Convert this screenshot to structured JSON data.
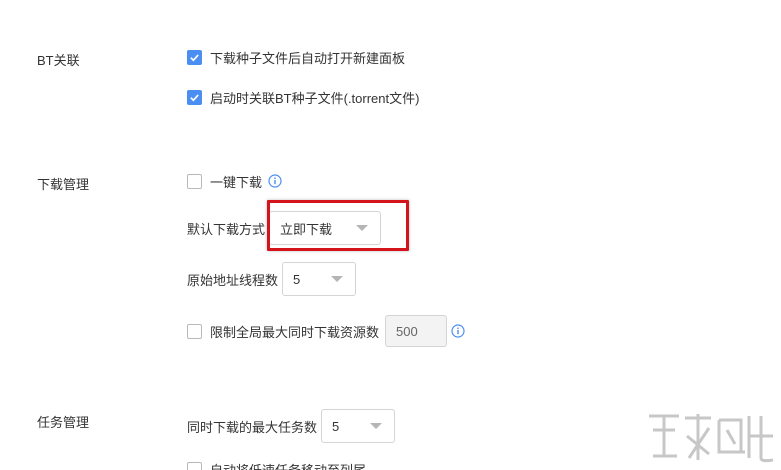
{
  "bt": {
    "label": "BT关联",
    "opt_open_panel": "下载种子文件后自动打开新建面板",
    "opt_associate": "启动时关联BT种子文件(.torrent文件)"
  },
  "download": {
    "label": "下载管理",
    "one_click": "一键下载",
    "default_mode_label": "默认下载方式",
    "default_mode_value": "立即下载",
    "threads_label": "原始地址线程数",
    "threads_value": "5",
    "limit_label": "限制全局最大同时下载资源数",
    "limit_value": "500"
  },
  "task": {
    "label": "任务管理",
    "max_tasks_label": "同时下载的最大任务数",
    "max_tasks_value": "5",
    "auto_move_label": "自动将低速任务移动至列尾"
  },
  "colors": {
    "accent": "#4b8ef2",
    "highlight": "#d3151b"
  },
  "icons": {
    "checked": "checkmark-icon",
    "info": "info-icon",
    "dropdown": "chevron-down-icon"
  }
}
